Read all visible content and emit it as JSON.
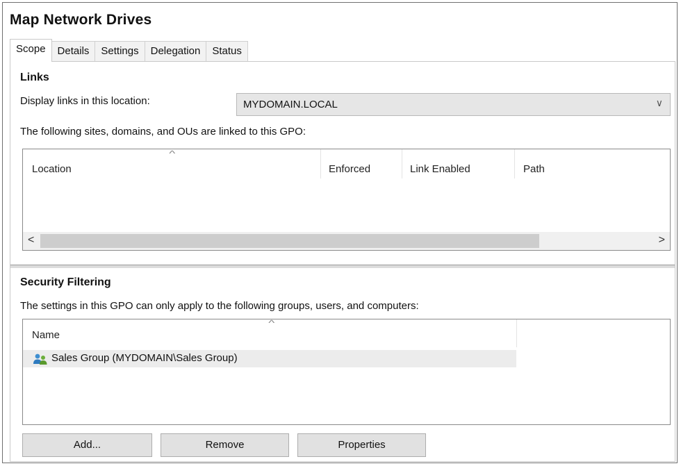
{
  "window": {
    "title": "Map Network Drives"
  },
  "tabs": [
    {
      "label": "Scope",
      "active": true
    },
    {
      "label": "Details"
    },
    {
      "label": "Settings"
    },
    {
      "label": "Delegation"
    },
    {
      "label": "Status"
    }
  ],
  "links": {
    "heading": "Links",
    "display_label": "Display links in this location:",
    "location_value": "MYDOMAIN.LOCAL",
    "linked_text": "The following sites, domains, and OUs are linked to this GPO:",
    "columns": [
      "Location",
      "Enforced",
      "Link Enabled",
      "Path"
    ],
    "scroll_left": "<",
    "scroll_right": ">",
    "dropdown_chevron": "∨"
  },
  "security": {
    "heading": "Security Filtering",
    "description": "The settings in this GPO can only apply to the following groups, users, and computers:",
    "column": "Name",
    "items": [
      {
        "label": "Sales Group (MYDOMAIN\\Sales Group)",
        "icon": "users-group-icon"
      }
    ],
    "buttons": {
      "add": "Add...",
      "remove": "Remove",
      "properties": "Properties"
    }
  },
  "colors": {
    "selected_row": "#ececec",
    "button_bg": "#e1e1e1",
    "scroll_thumb": "#cdcdcd"
  }
}
